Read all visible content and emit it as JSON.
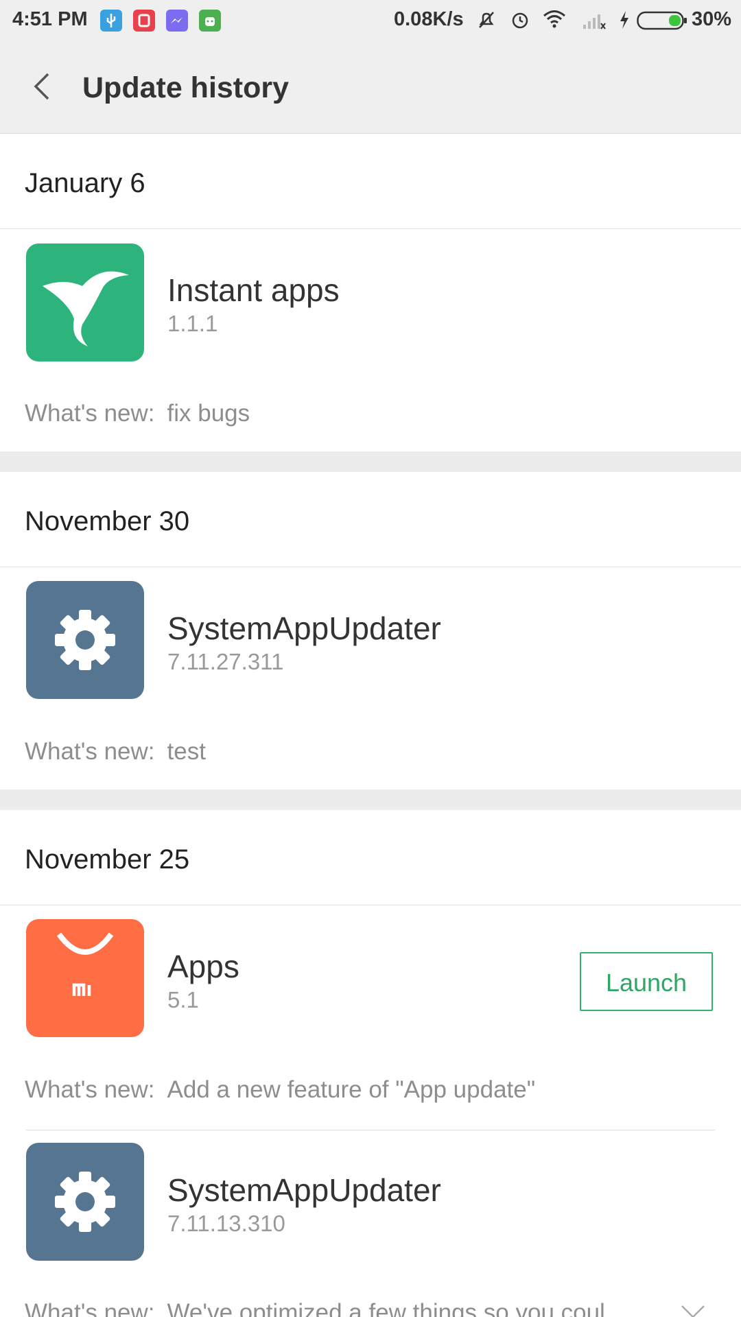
{
  "status_bar": {
    "time": "4:51 PM",
    "net_speed": "0.08K/s",
    "battery": "30%"
  },
  "header": {
    "title": "Update history"
  },
  "sections": [
    {
      "date": "January 6",
      "items": [
        {
          "name": "Instant apps",
          "version": "1.1.1",
          "whats_new_label": "What's new:",
          "whats_new": "fix bugs",
          "icon": "hummingbird-icon"
        }
      ]
    },
    {
      "date": "November 30",
      "items": [
        {
          "name": "SystemAppUpdater",
          "version": "7.11.27.311",
          "whats_new_label": "What's new:",
          "whats_new": "test",
          "icon": "gear-icon"
        }
      ]
    },
    {
      "date": "November 25",
      "items": [
        {
          "name": "Apps",
          "version": "5.1",
          "whats_new_label": "What's new:",
          "whats_new": "Add a new feature of \"App update\"",
          "icon": "mi-bag-icon",
          "action": "Launch"
        },
        {
          "name": "SystemAppUpdater",
          "version": "7.11.13.310",
          "whats_new_label": "What's new:",
          "whats_new": "We've optimized a few things so you coul",
          "icon": "gear-icon"
        }
      ]
    }
  ],
  "colors": {
    "instant_apps": "#2db47d",
    "system_updater": "#567590",
    "mi_apps": "#ff6d45",
    "launch_accent": "#2ea665"
  }
}
